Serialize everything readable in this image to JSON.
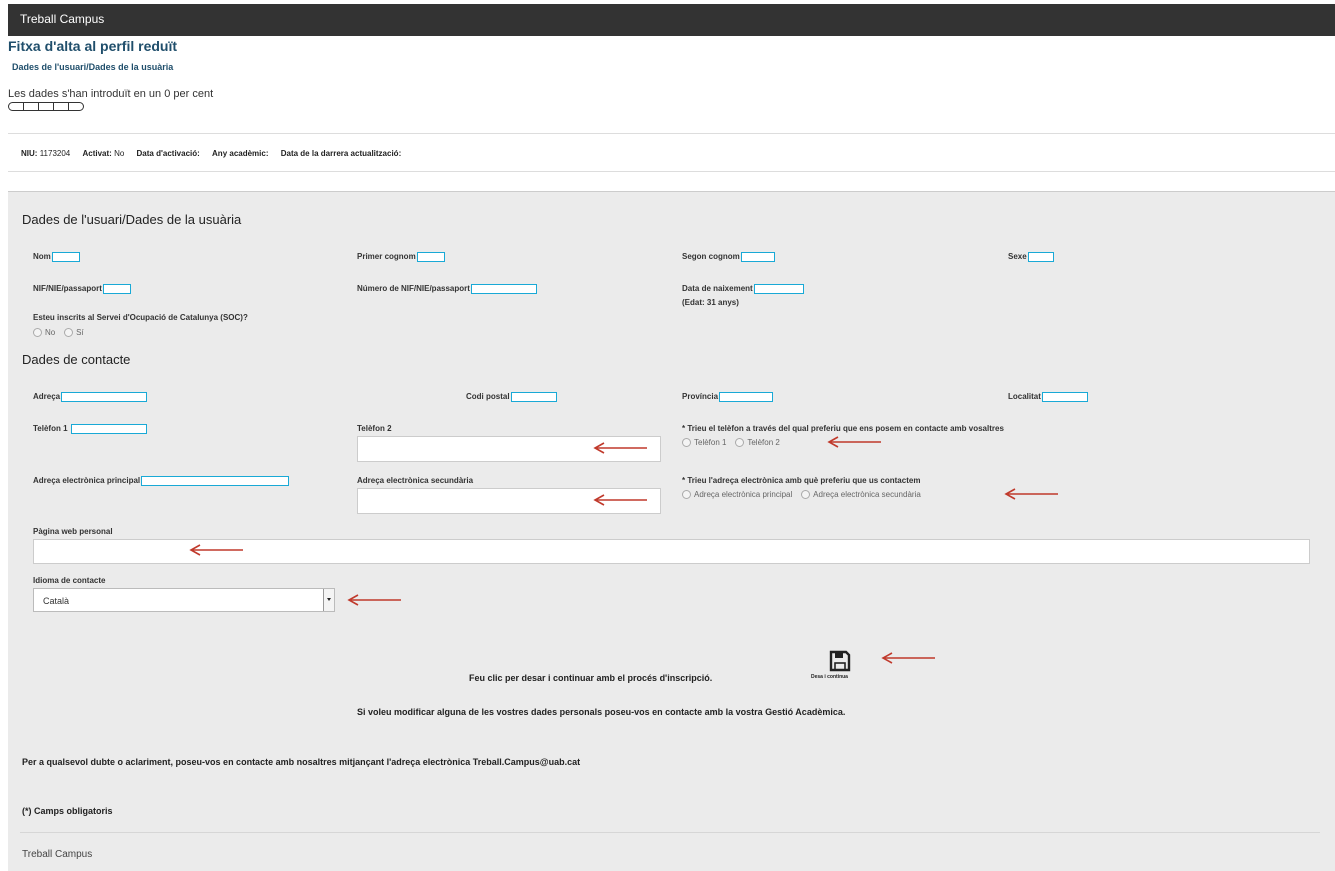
{
  "header": {
    "app_title": "Treball Campus"
  },
  "page": {
    "title": "Fitxa d'alta al perfil reduït",
    "subtitle": "Dades de l'usuari/Dades de la usuària",
    "progress_text": "Les dades s'han introduït en un 0 per cent",
    "progress_percent": 0
  },
  "info": {
    "niu_label": "NIU:",
    "niu_value": "1173204",
    "activat_label": "Activat:",
    "activat_value": "No",
    "data_activacio_label": "Data d'activació:",
    "any_academic_label": "Any acadèmic:",
    "data_actualitzacio_label": "Data de la darrera actualització:"
  },
  "user_section": {
    "title": "Dades de l'usuari/Dades de la usuària",
    "nom_label": "Nom",
    "primer_cognom_label": "Primer cognom",
    "segon_cognom_label": "Segon cognom",
    "sexe_label": "Sexe",
    "nif_label": "NIF/NIE/passaport",
    "num_nif_label": "Número de NIF/NIE/passaport",
    "naixement_label": "Data de naixement",
    "edat_text": "(Edat: 31 anys)",
    "soc_question": "Esteu inscrits al Servei d'Ocupació de Catalunya (SOC)?",
    "soc_no": "No",
    "soc_si": "Sí"
  },
  "contact_section": {
    "title": "Dades de contacte",
    "adreca_label": "Adreça",
    "codi_postal_label": "Codi postal",
    "provincia_label": "Província",
    "localitat_label": "Localitat",
    "telefon1_label": "Telèfon 1",
    "telefon2_label": "Telèfon 2",
    "telefon_pref_label": "* Trieu el telèfon a través del qual preferiu que ens posem en contacte amb vosaltres",
    "telefon_pref_opt1": "Telèfon 1",
    "telefon_pref_opt2": "Telèfon 2",
    "email_principal_label": "Adreça electrònica principal",
    "email_secundaria_label": "Adreça electrònica secundària",
    "email_pref_label": "* Trieu l'adreça electrònica amb què preferiu que us contactem",
    "email_pref_opt1": "Adreça electrònica principal",
    "email_pref_opt2": "Adreça electrònica secundària",
    "web_label": "Pàgina web personal",
    "idioma_label": "Idioma de contacte",
    "idioma_value": "Català"
  },
  "actions": {
    "save_prompt": "Feu clic per desar i continuar amb el procés d'inscripció.",
    "save_caption": "Desa i continua",
    "modify_note": "Si voleu modificar alguna de les vostres dades personals poseu-vos en contacte amb la vostra Gestió Acadèmica."
  },
  "notes": {
    "doubts": "Per a qualsevol dubte o aclariment, poseu-vos en contacte amb nosaltres mitjançant l'adreça electrònica Treball.Campus@uab.cat",
    "required": "(*) Camps obligatoris"
  },
  "footer": {
    "text": "Treball Campus"
  },
  "colors": {
    "topbar": "#333333",
    "title": "#1f4e6b",
    "field_border": "#19a9d6",
    "annotation_arrow": "#c0392b"
  }
}
